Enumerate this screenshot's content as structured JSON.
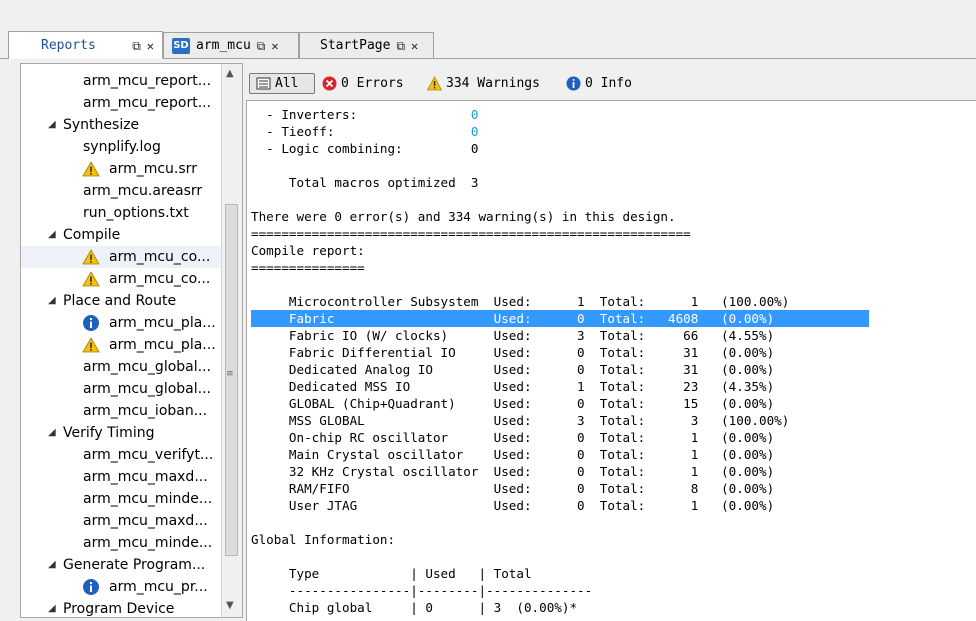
{
  "tabs": [
    {
      "title": "Reports",
      "icons": [
        "⧉",
        "✕"
      ]
    },
    {
      "badge": "SD",
      "title": "arm_mcu",
      "icons": [
        "⧉",
        "✕"
      ]
    },
    {
      "title": "StartPage",
      "icons": [
        "⧉",
        "✕"
      ]
    }
  ],
  "tree": [
    {
      "label": "arm_mcu_report...",
      "indent": 2
    },
    {
      "label": "arm_mcu_report...",
      "indent": 2
    },
    {
      "label": "Synthesize",
      "indent": 1,
      "expanded": true
    },
    {
      "label": "synplify.log",
      "indent": 2
    },
    {
      "label": "arm_mcu.srr",
      "indent": 2,
      "icon": "warning"
    },
    {
      "label": "arm_mcu.areasrr",
      "indent": 2
    },
    {
      "label": "run_options.txt",
      "indent": 2
    },
    {
      "label": "Compile",
      "indent": 1,
      "expanded": true
    },
    {
      "label": "arm_mcu_co...",
      "indent": 2,
      "icon": "warning",
      "selected": true
    },
    {
      "label": "arm_mcu_co...",
      "indent": 2,
      "icon": "warning"
    },
    {
      "label": "Place and Route",
      "indent": 1,
      "expanded": true
    },
    {
      "label": "arm_mcu_pla...",
      "indent": 2,
      "icon": "info"
    },
    {
      "label": "arm_mcu_pla...",
      "indent": 2,
      "icon": "warning"
    },
    {
      "label": "arm_mcu_global...",
      "indent": 2
    },
    {
      "label": "arm_mcu_global...",
      "indent": 2
    },
    {
      "label": "arm_mcu_ioban...",
      "indent": 2
    },
    {
      "label": "Verify Timing",
      "indent": 1,
      "expanded": true
    },
    {
      "label": "arm_mcu_verifyt...",
      "indent": 2
    },
    {
      "label": "arm_mcu_maxd...",
      "indent": 2
    },
    {
      "label": "arm_mcu_minde...",
      "indent": 2
    },
    {
      "label": "arm_mcu_maxd...",
      "indent": 2
    },
    {
      "label": "arm_mcu_minde...",
      "indent": 2
    },
    {
      "label": "Generate Program...",
      "indent": 1,
      "expanded": true
    },
    {
      "label": "arm_mcu_pr...",
      "indent": 2,
      "icon": "info"
    },
    {
      "label": "Program Device",
      "indent": 1,
      "expanded": true
    }
  ],
  "filters": {
    "all": "All",
    "errors": "0 Errors",
    "warnings": "334 Warnings",
    "info": "0 Info"
  },
  "log": [
    {
      "text": "  - Inverters:               ",
      "value": "0",
      "value_blue": true
    },
    {
      "text": "  - Tieoff:                  ",
      "value": "0",
      "value_blue": true
    },
    {
      "text": "  - Logic combining:         ",
      "value": "0"
    },
    {
      "text": ""
    },
    {
      "text": "     Total macros optimized  3"
    },
    {
      "text": ""
    },
    {
      "text": "There were 0 error(s) and 334 warning(s) in this design."
    },
    {
      "text": "=========================================================="
    },
    {
      "text": "Compile report:"
    },
    {
      "text": "==============="
    },
    {
      "text": ""
    },
    {
      "text": "     Microcontroller Subsystem  Used:      1  Total:      1   (100.00%)"
    },
    {
      "text": "     Fabric                     Used:      0  Total:   4608   (0.00%)",
      "highlight": true
    },
    {
      "text": "     Fabric IO (W/ clocks)      Used:      3  Total:     66   (4.55%)"
    },
    {
      "text": "     Fabric Differential IO     Used:      0  Total:     31   (0.00%)"
    },
    {
      "text": "     Dedicated Analog IO        Used:      0  Total:     31   (0.00%)"
    },
    {
      "text": "     Dedicated MSS IO           Used:      1  Total:     23   (4.35%)"
    },
    {
      "text": "     GLOBAL (Chip+Quadrant)     Used:      0  Total:     15   (0.00%)"
    },
    {
      "text": "     MSS GLOBAL                 Used:      3  Total:      3   (100.00%)"
    },
    {
      "text": "     On-chip RC oscillator      Used:      0  Total:      1   (0.00%)"
    },
    {
      "text": "     Main Crystal oscillator    Used:      0  Total:      1   (0.00%)"
    },
    {
      "text": "     32 KHz Crystal oscillator  Used:      0  Total:      1   (0.00%)"
    },
    {
      "text": "     RAM/FIFO                   Used:      0  Total:      8   (0.00%)"
    },
    {
      "text": "     User JTAG                  Used:      0  Total:      1   (0.00%)"
    },
    {
      "text": ""
    },
    {
      "text": "Global Information:"
    },
    {
      "text": ""
    },
    {
      "text": "     Type            | Used   | Total"
    },
    {
      "text": "     ----------------|--------|--------------"
    },
    {
      "text": "     Chip global     | 0      | 3  (0.00%)*"
    }
  ]
}
